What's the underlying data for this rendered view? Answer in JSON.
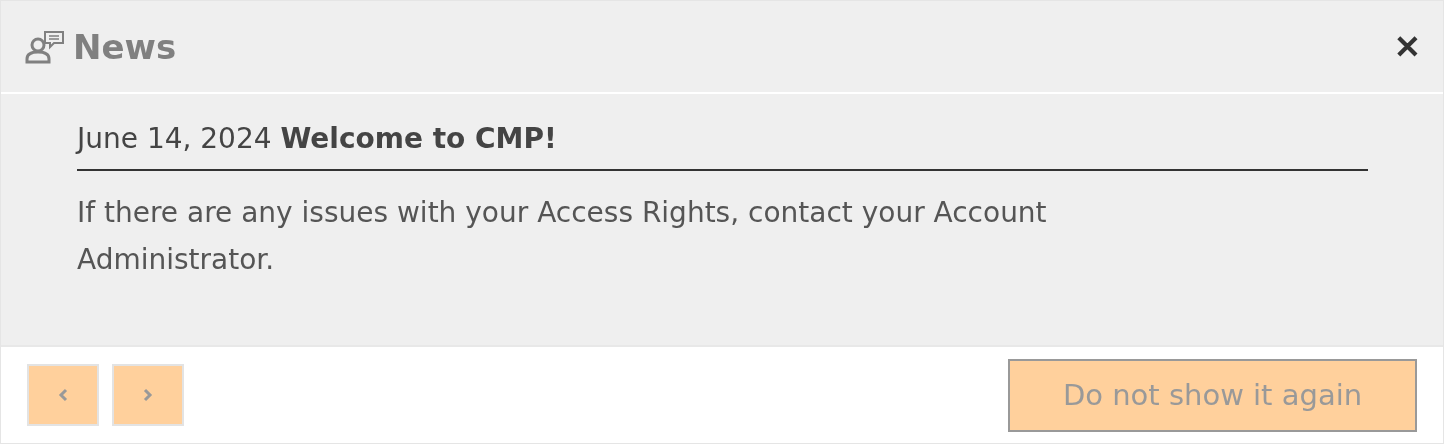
{
  "dialog": {
    "title": "News",
    "close_label": "✕"
  },
  "news_item": {
    "headline": "June 14, 2024 **Welcome to CMP!**",
    "body": "If there are any issues with your Access Rights, contact your Account Administrator."
  },
  "footer": {
    "previous": {
      "disabled": true
    },
    "next": {
      "disabled": true
    },
    "dismiss": {
      "label": "Do not show it again",
      "disabled": true
    }
  }
}
